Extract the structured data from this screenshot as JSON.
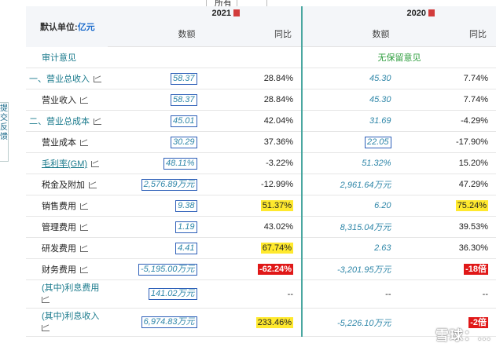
{
  "filter": {
    "value": "所有"
  },
  "feedback": {
    "label": "提交反馈"
  },
  "header": {
    "unit_label": "默认单位:",
    "unit": "亿元",
    "years": [
      "2021",
      "2020"
    ],
    "col_amount": "数额",
    "col_yoy": "同比"
  },
  "rows": [
    {
      "label": "审计意见",
      "v1": "",
      "p1": "",
      "v2": "无保留意见",
      "p2": ""
    },
    {
      "label": "一、营业总收入",
      "v1": "58.37",
      "p1": "28.84%",
      "v2": "45.30",
      "p2": "7.74%"
    },
    {
      "label": "营业收入",
      "v1": "58.37",
      "p1": "28.84%",
      "v2": "45.30",
      "p2": "7.74%"
    },
    {
      "label": "二、营业总成本",
      "v1": "45.01",
      "p1": "42.04%",
      "v2": "31.69",
      "p2": "-4.29%"
    },
    {
      "label": "营业成本",
      "v1": "30.29",
      "p1": "37.36%",
      "v2": "22.05",
      "p2": "-17.90%"
    },
    {
      "label": "毛利率(GM)",
      "v1": "48.11%",
      "p1": "-3.22%",
      "v2": "51.32%",
      "p2": "15.20%"
    },
    {
      "label": "税金及附加",
      "v1": "2,576.89万元",
      "p1": "-12.99%",
      "v2": "2,961.64万元",
      "p2": "47.29%"
    },
    {
      "label": "销售费用",
      "v1": "9.38",
      "p1": "51.37%",
      "v2": "6.20",
      "p2": "75.24%"
    },
    {
      "label": "管理费用",
      "v1": "1.19",
      "p1": "43.02%",
      "v2": "8,315.04万元",
      "p2": "39.53%"
    },
    {
      "label": "研发费用",
      "v1": "4.41",
      "p1": "67.74%",
      "v2": "2.63",
      "p2": "36.30%"
    },
    {
      "label": "财务费用",
      "v1": "-5,195.00万元",
      "p1": "-62.24%",
      "v2": "-3,201.95万元",
      "p2": "-18倍"
    },
    {
      "label_a": "(其中)利息费用",
      "v1": "141.02万元",
      "p1": "--",
      "v2": "--",
      "p2": "--"
    },
    {
      "label_a": "(其中)利息收入",
      "v1": "6,974.83万元",
      "p1": "233.46%",
      "v2": "-5,226.10万元",
      "p2": "-2倍"
    }
  ],
  "watermark": "雪球：..."
}
